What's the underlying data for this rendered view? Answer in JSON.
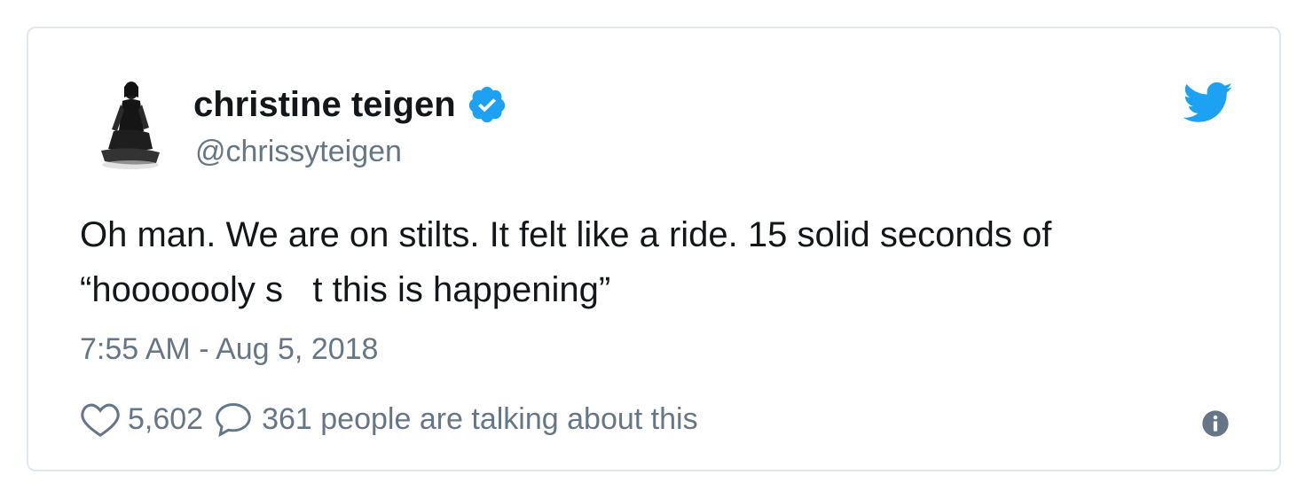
{
  "tweet": {
    "author_name": "christine teigen",
    "author_handle": "@chrissyteigen",
    "verified": true,
    "text": "Oh man. We are on stilts. It felt like a ride. 15 solid seconds of\n“hoooooo​ly s   t this is happening”",
    "timestamp": "7:55 AM - Aug 5, 2018",
    "like_count": "5,602",
    "talking_text": "361 people are talking about this"
  },
  "icons": {
    "avatar": "avatar-photo",
    "verified": "verified-badge-icon",
    "brand": "twitter-bird-icon",
    "like": "heart-icon",
    "reply": "speech-bubble-icon",
    "info": "info-icon"
  },
  "colors": {
    "twitter_blue": "#1da1f2",
    "text_primary": "#14171a",
    "text_secondary": "#657786",
    "border": "#e1e8ed"
  }
}
